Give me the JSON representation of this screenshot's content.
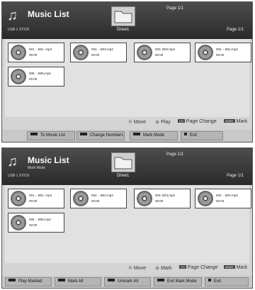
{
  "screens": [
    {
      "title": "Music List",
      "subtitle": "",
      "usb": "USB 1 XTICK",
      "drive": "Drive1",
      "page_top": "Page 1/1",
      "page_right": "Page 1/1",
      "files": [
        {
          "name": "001. - B01 .mp3",
          "time": "00:00"
        },
        {
          "name": "002. - B02.mp3",
          "time": "00:00"
        },
        {
          "name": "003. B03.mp3",
          "time": "00:00"
        },
        {
          "name": "004. - B04.mp3",
          "time": "00:00"
        },
        {
          "name": "005. - B05.mp3",
          "time": "00:00"
        }
      ],
      "keys": {
        "move": "Move",
        "action": "Play",
        "page_change": "Page Change",
        "mark": "Mark",
        "mark_box": "MARK",
        "ch_box": "CH"
      },
      "buttons": [
        "To Movie List",
        "Change Numbers",
        "Mark Mode",
        "Exit"
      ]
    },
    {
      "title": "Music List",
      "subtitle": "Mark Mode",
      "usb": "USB 1 XTICK",
      "drive": "Drive1",
      "page_top": "Page 1/1",
      "page_right": "Page 1/1",
      "files": [
        {
          "name": "001. - B01 .mp3",
          "time": "00:00"
        },
        {
          "name": "002. - B02.mp3",
          "time": "00:00"
        },
        {
          "name": "003. B03.mp3",
          "time": "00:00"
        },
        {
          "name": "004. - B04.mp3",
          "time": "00:00"
        },
        {
          "name": "005. - B05.mp3",
          "time": "00:00"
        }
      ],
      "keys": {
        "move": "Move",
        "action": "Mark",
        "page_change": "Page Change",
        "mark": "Mark",
        "mark_box": "MARK",
        "ch_box": "CH"
      },
      "buttons": [
        "Play Marked",
        "Mark All",
        "Unmark All",
        "Exit Mark Mode",
        "Exit"
      ]
    }
  ]
}
